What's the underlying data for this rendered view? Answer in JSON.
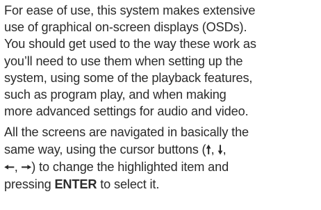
{
  "paragraph1": {
    "lines": [
      "For ease of use, this system makes extensive",
      "use of graphical on-screen displays (OSDs).",
      "You should get used to the way these work as",
      "you’ll need to use them when setting up the",
      "system, using some of the playback features,",
      "such as program play, and when making",
      "more advanced settings for audio and video."
    ]
  },
  "paragraph2": {
    "line1": "All the screens are navigated in basically the",
    "line2_before": "same way, using the cursor buttons (",
    "arrow_up": "🠕",
    "sep1": ", ",
    "arrow_down": "🠗",
    "sep2": ",",
    "arrow_left": "🠔",
    "sep3": ", ",
    "arrow_right": "🠖",
    "line3_after": ") to change the highlighted item and",
    "line4_before": "pressing ",
    "enter_key": "ENTER",
    "line4_after": " to select it."
  }
}
